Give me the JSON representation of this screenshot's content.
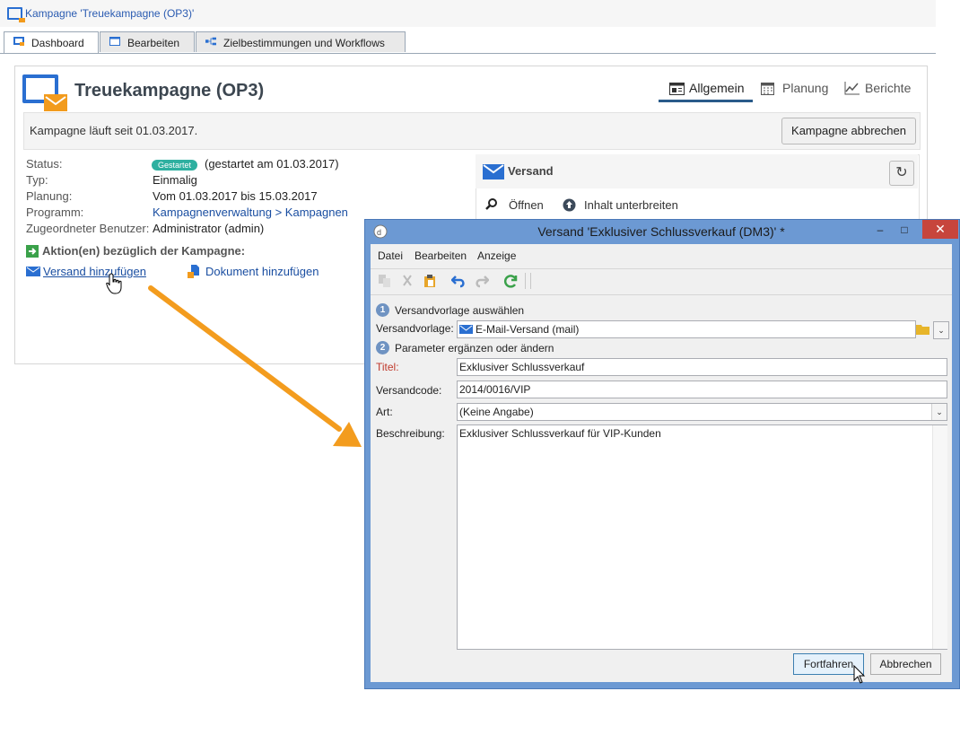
{
  "window": {
    "title": "Kampagne 'Treuekampagne (OP3)'"
  },
  "tabs": [
    {
      "label": "Dashboard"
    },
    {
      "label": "Bearbeiten"
    },
    {
      "label": "Zielbestimmungen und Workflows"
    }
  ],
  "campaign": {
    "title": "Treuekampagne (OP3)",
    "view_tabs": [
      {
        "label": "Allgemein"
      },
      {
        "label": "Planung"
      },
      {
        "label": "Berichte"
      }
    ],
    "info_text": "Kampagne läuft seit 01.03.2017.",
    "cancel_button": "Kampagne abbrechen",
    "fields": {
      "status_label": "Status:",
      "status_badge": "Gestartet",
      "status_extra": "(gestartet am 01.03.2017)",
      "typ_label": "Typ:",
      "typ_value": "Einmalig",
      "planung_label": "Planung:",
      "planung_value": "Vom 01.03.2017 bis 15.03.2017",
      "programm_label": "Programm:",
      "programm_value": "Kampagnenverwaltung > Kampagnen",
      "benutzer_label": "Zugeordneter Benutzer:",
      "benutzer_value": "Administrator (admin)"
    },
    "actions_heading": "Aktion(en) bezüglich der Kampagne:",
    "action_links": [
      {
        "label": "Versand hinzufügen"
      },
      {
        "label": "Dokument hinzufügen"
      }
    ],
    "versand_panel": {
      "title": "Versand",
      "open_label": "Öffnen",
      "submit_label": "Inhalt unterbreiten"
    }
  },
  "dialog": {
    "title": "Versand 'Exklusiver Schlussverkauf (DM3)' *",
    "menu": [
      "Datei",
      "Bearbeiten",
      "Anzeige"
    ],
    "step1": {
      "num": "1",
      "label": "Versandvorlage auswählen"
    },
    "template_label": "Versandvorlage:",
    "template_value": "E-Mail-Versand (mail)",
    "step2": {
      "num": "2",
      "label": "Parameter ergänzen oder ändern"
    },
    "titel_label": "Titel:",
    "titel_value": "Exklusiver Schlussverkauf",
    "code_label": "Versandcode:",
    "code_value": "2014/0016/VIP",
    "art_label": "Art:",
    "art_value": "(Keine Angabe)",
    "desc_label": "Beschreibung:",
    "desc_value": "Exklusiver Schlussverkauf für VIP-Kunden",
    "btn_continue": "Fortfahren",
    "btn_cancel": "Abbrechen"
  },
  "colors": {
    "accent": "#2a6fd1",
    "orange": "#f29b1d",
    "link": "#1a4ea1",
    "badge": "#2eb0a0",
    "dialog_frame": "#6c99d3",
    "close_red": "#c7453c"
  }
}
